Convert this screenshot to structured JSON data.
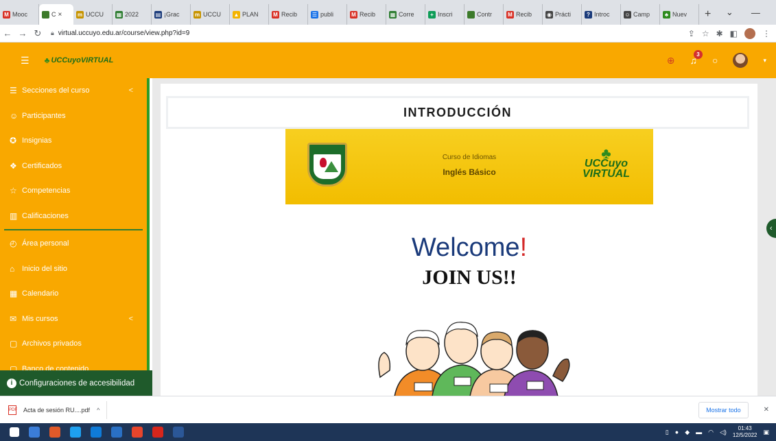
{
  "browser": {
    "tabs": [
      {
        "label": "Mooc",
        "color": "#d93025",
        "glyph": "M"
      },
      {
        "label": "C",
        "color": "#3c7a2a",
        "glyph": "",
        "active": true
      },
      {
        "label": "UCCU",
        "color": "#c79400",
        "glyph": "m"
      },
      {
        "label": "2022",
        "color": "#2e7d32",
        "glyph": "▦"
      },
      {
        "label": "¡Grac",
        "color": "#1a3a7a",
        "glyph": "▤"
      },
      {
        "label": "UCCU",
        "color": "#c79400",
        "glyph": "m"
      },
      {
        "label": "PLAN",
        "color": "#f4b400",
        "glyph": "▲"
      },
      {
        "label": "Recib",
        "color": "#d93025",
        "glyph": "M"
      },
      {
        "label": "publi",
        "color": "#1a73e8",
        "glyph": "☰"
      },
      {
        "label": "Recib",
        "color": "#d93025",
        "glyph": "M"
      },
      {
        "label": "Corre",
        "color": "#2e7d32",
        "glyph": "▦"
      },
      {
        "label": "Inscri",
        "color": "#0f9d58",
        "glyph": "+"
      },
      {
        "label": "Contr",
        "color": "#3c7a2a",
        "glyph": ""
      },
      {
        "label": "Recib",
        "color": "#d93025",
        "glyph": "M"
      },
      {
        "label": "Prácti",
        "color": "#444444",
        "glyph": "◉"
      },
      {
        "label": "Introc",
        "color": "#1a3a7a",
        "glyph": "?"
      },
      {
        "label": "Camp",
        "color": "#444444",
        "glyph": "☺"
      },
      {
        "label": "Nuev",
        "color": "#2e8b1e",
        "glyph": "♣"
      }
    ],
    "active_tab_close": "×",
    "new_tab": "+",
    "url": "virtual.uccuyo.edu.ar/course/view.php?id=9"
  },
  "navbar": {
    "brand": "UCCuyoVIRTUAL",
    "notification_count": "3"
  },
  "sidebar": {
    "items": [
      {
        "name": "sidebar-item-secciones",
        "icon": "☰",
        "label": "Secciones del curso",
        "chevron": "<"
      },
      {
        "name": "sidebar-item-participantes",
        "icon": "☺",
        "label": "Participantes",
        "chevron": ""
      },
      {
        "name": "sidebar-item-insignias",
        "icon": "✪",
        "label": "Insignias",
        "chevron": ""
      },
      {
        "name": "sidebar-item-certificados",
        "icon": "❖",
        "label": "Certificados",
        "chevron": ""
      },
      {
        "name": "sidebar-item-competencias",
        "icon": "☆",
        "label": "Competencias",
        "chevron": ""
      },
      {
        "name": "sidebar-item-calificaciones",
        "icon": "▥",
        "label": "Calificaciones",
        "chevron": ""
      }
    ],
    "items2": [
      {
        "name": "sidebar-item-area-personal",
        "icon": "◴",
        "label": "Área personal",
        "chevron": ""
      },
      {
        "name": "sidebar-item-inicio",
        "icon": "⌂",
        "label": "Inicio del sitio",
        "chevron": ""
      },
      {
        "name": "sidebar-item-calendario",
        "icon": "▦",
        "label": "Calendario",
        "chevron": ""
      },
      {
        "name": "sidebar-item-mis-cursos",
        "icon": "✉",
        "label": "Mis cursos",
        "chevron": "<"
      },
      {
        "name": "sidebar-item-archivos",
        "icon": "▢",
        "label": "Archivos privados",
        "chevron": ""
      },
      {
        "name": "sidebar-item-banco",
        "icon": "▢",
        "label": "Banco de contenido",
        "chevron": ""
      }
    ],
    "accessibility": "Configuraciones de accesibilidad"
  },
  "main": {
    "section_title": "INTRODUCCIÓN",
    "banner": {
      "subtitle": "Curso de Idiomas",
      "title": "Inglés Básico",
      "logo_line1": "UCCuyo",
      "logo_line2": "VIRTUAL"
    },
    "welcome": {
      "word": "Welcome",
      "excl": "!",
      "join": "JOIN US!!"
    }
  },
  "downloads": {
    "file": "Acta de sesión RU....pdf",
    "show_all": "Mostrar todo"
  },
  "taskbar": {
    "time": "01:43",
    "date": "12/5/2022"
  },
  "colors": {
    "brand_orange": "#f9a800",
    "brand_green": "#2e9b27",
    "dark_green": "#1f5a2b"
  }
}
